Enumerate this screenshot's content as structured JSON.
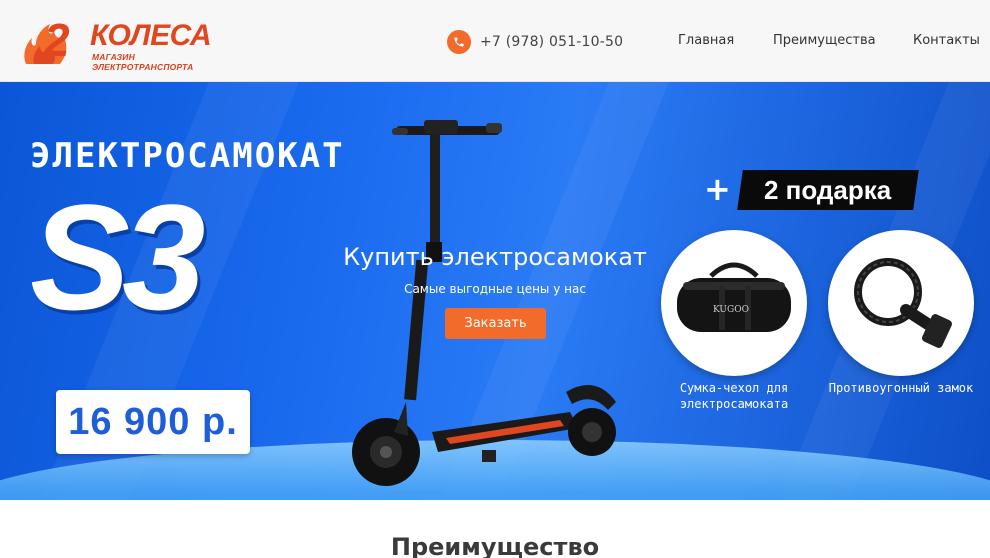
{
  "header": {
    "logo": {
      "number": "2",
      "name": "КОЛЕСА",
      "tagline": "МАГАЗИН ЭЛЕКТРОТРАНСПОРТА"
    },
    "phone": "+7 (978) 051-10-50",
    "nav": [
      "Главная",
      "Преимущества",
      "Контакты"
    ]
  },
  "hero": {
    "caption": "ЭЛЕКТРОСАМОКАТ",
    "model": "S3",
    "price": "16 900 р.",
    "cta": {
      "title": "Купить электросамокат",
      "subtitle": "Самые выгодные цены у нас",
      "button": "Заказать"
    },
    "gifts": {
      "plus": "+",
      "banner": "2 подарка",
      "items": [
        {
          "label": "Сумка-чехол для электросамоката",
          "brand": "KUGOO",
          "icon": "bag-icon"
        },
        {
          "label": "Противоугонный замок",
          "icon": "lock-icon"
        }
      ]
    }
  },
  "section": {
    "title": "Преимущество"
  },
  "colors": {
    "accent": "#f26b2a",
    "brand": "#e0461f",
    "hero_blue": "#1c6cf0"
  }
}
